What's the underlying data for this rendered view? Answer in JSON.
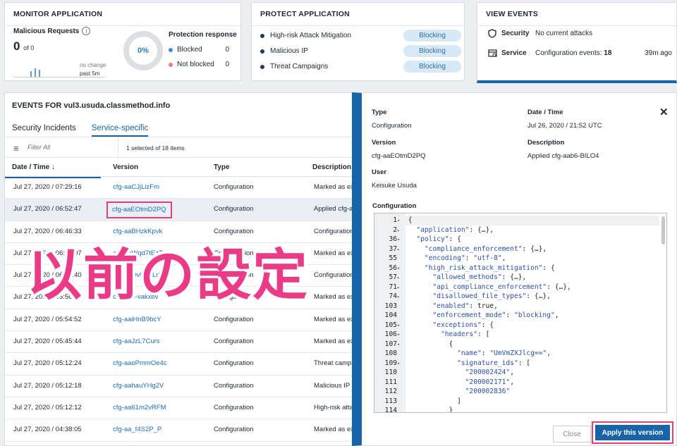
{
  "monitor": {
    "title": "MONITOR APPLICATION",
    "malicious_label": "Malicious Requests",
    "info_icon": "i",
    "count": "0",
    "count_suffix": "of 0",
    "no_change": "no change",
    "past": "past 5m",
    "percent": "0%",
    "protection_response": "Protection response",
    "blocked_label": "Blocked",
    "blocked_value": "0",
    "not_blocked_label": "Not blocked",
    "not_blocked_value": "0",
    "blocked_color": "#3b8fd1",
    "not_blocked_color": "#e87a8a"
  },
  "protect": {
    "title": "PROTECT APPLICATION",
    "rows": [
      {
        "label": "High-risk Attack Mitigation",
        "status": "Blocking"
      },
      {
        "label": "Malicious IP",
        "status": "Blocking"
      },
      {
        "label": "Threat Campaigns",
        "status": "Blocking"
      }
    ]
  },
  "view_events": {
    "title": "VIEW EVENTS",
    "security_label": "Security",
    "security_value": "No current attacks",
    "service_label": "Service",
    "service_value_prefix": "Configuration events:",
    "service_value_count": "18",
    "service_time": "39m ago"
  },
  "events": {
    "title": "EVENTS FOR vul3.usuda.classmethod.info",
    "tabs": [
      "Security Incidents",
      "Service-specific"
    ],
    "filter_placeholder": "Filter All",
    "selected_count": "1 selected of 18 items",
    "columns": [
      "Date / Time ↓",
      "Version",
      "Type",
      "Description"
    ],
    "rows": [
      {
        "date": "Jul 27, 2020 / 07:29:16",
        "version": "cfg-aaCJjLizFm",
        "type": "Configuration",
        "desc": "Marked as ex"
      },
      {
        "date": "Jul 27, 2020 / 06:52:47",
        "version": "cfg-aaEOtmD2PQ",
        "type": "Configuration",
        "desc": "Applied cfg-a"
      },
      {
        "date": "Jul 27, 2020 / 06:46:33",
        "version": "cfg-aaBHzkKpvk",
        "type": "Configuration",
        "desc": "Configuration"
      },
      {
        "date": "Jul 27, 2020 / 06:23:07",
        "version": "cfg-aaWqd7tEzT",
        "type": "Configuration",
        "desc": "Marked as ex"
      },
      {
        "date": "Jul 27, 2020 / 06:01:40",
        "version": "cfg-aaQvN3pLr8",
        "type": "Configuration",
        "desc": "Configuration"
      },
      {
        "date": "Jul 27, 2020 / 05:56:49",
        "version": "cfg-aae-vakxbv",
        "type": "Configuration",
        "desc": "Marked as ex"
      },
      {
        "date": "Jul 27, 2020 / 05:54:52",
        "version": "cfg-aaiHnB9bcY",
        "type": "Configuration",
        "desc": "Marked as ex"
      },
      {
        "date": "Jul 27, 2020 / 05:45:44",
        "version": "cfg-aaJzL7Curs",
        "type": "Configuration",
        "desc": "Marked as ex"
      },
      {
        "date": "Jul 27, 2020 / 05:12:24",
        "version": "cfg-aaoPmmOe4c",
        "type": "Configuration",
        "desc": "Threat camp"
      },
      {
        "date": "Jul 27, 2020 / 05:12:18",
        "version": "cfg-aahauYHg2V",
        "type": "Configuration",
        "desc": "Malicious IP"
      },
      {
        "date": "Jul 27, 2020 / 05:12:12",
        "version": "cfg-aa61m2vRFM",
        "type": "Configuration",
        "desc": "High-risk atta"
      },
      {
        "date": "Jul 27, 2020 / 04:38:05",
        "version": "cfg-aa_f4S2P_P",
        "type": "Configuration",
        "desc": "Marked as ex"
      }
    ]
  },
  "overlay": "以前の設定",
  "detail": {
    "type_label": "Type",
    "type_value": "Configuration",
    "date_label": "Date / Time",
    "date_value": "Jul 26, 2020 / 21:52 UTC",
    "version_label": "Version",
    "version_value": "cfg-aaEOtmD2PQ",
    "desc_label": "Description",
    "desc_value": "Applied cfg-aab6-BILO4",
    "user_label": "User",
    "user_value": "Keisuke Usuda",
    "config_label": "Configuration",
    "close_glyph": "✕",
    "close_button": "Close",
    "apply_button": "Apply this version",
    "code": [
      {
        "ln": "1",
        "fold": "▾",
        "text": "{"
      },
      {
        "ln": "2",
        "fold": "▸",
        "text": "  \"application\": {…},"
      },
      {
        "ln": "36",
        "fold": "▾",
        "text": "  \"policy\": {"
      },
      {
        "ln": "37",
        "fold": "▸",
        "text": "    \"compliance_enforcement\": {…},"
      },
      {
        "ln": "55",
        "fold": "",
        "text": "    \"encoding\": \"utf-8\","
      },
      {
        "ln": "56",
        "fold": "▾",
        "text": "    \"high_risk_attack_mitigation\": {"
      },
      {
        "ln": "57",
        "fold": "▸",
        "text": "      \"allowed_methods\": {…},"
      },
      {
        "ln": "71",
        "fold": "▸",
        "text": "      \"api_compliance_enforcement\": {…},"
      },
      {
        "ln": "74",
        "fold": "▸",
        "text": "      \"disallowed_file_types\": {…},"
      },
      {
        "ln": "103",
        "fold": "",
        "text": "      \"enabled\": true,"
      },
      {
        "ln": "104",
        "fold": "",
        "text": "      \"enforcement_mode\": \"blocking\","
      },
      {
        "ln": "105",
        "fold": "▾",
        "text": "      \"exceptions\": {"
      },
      {
        "ln": "106",
        "fold": "▾",
        "text": "        \"headers\": ["
      },
      {
        "ln": "107",
        "fold": "▾",
        "text": "          {"
      },
      {
        "ln": "108",
        "fold": "",
        "text": "            \"name\": \"UmVmZXJlcg==\","
      },
      {
        "ln": "109",
        "fold": "▾",
        "text": "            \"signature_ids\": ["
      },
      {
        "ln": "110",
        "fold": "",
        "text": "              \"200002424\","
      },
      {
        "ln": "111",
        "fold": "",
        "text": "              \"200002171\","
      },
      {
        "ln": "112",
        "fold": "",
        "text": "              \"200002836\""
      },
      {
        "ln": "113",
        "fold": "",
        "text": "            ]"
      },
      {
        "ln": "114",
        "fold": "",
        "text": "          }"
      }
    ]
  }
}
